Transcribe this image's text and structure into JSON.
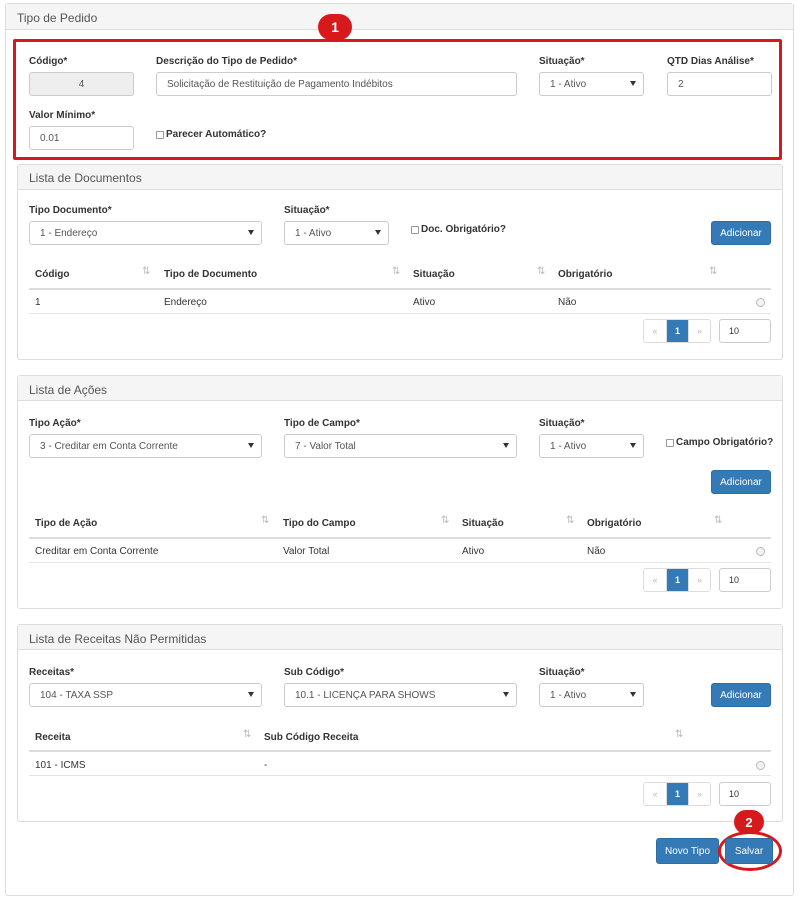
{
  "page": {
    "title": "Tipo de Pedido"
  },
  "order_type": {
    "codigo": {
      "label": "Código*",
      "value": "4"
    },
    "descricao": {
      "label": "Descrição do Tipo de Pedido*",
      "value": "Solicitação de Restituição de Pagamento Indébitos"
    },
    "situacao": {
      "label": "Situação*",
      "value": "1 - Ativo"
    },
    "qtd_dias": {
      "label": "QTD Dias Análise*",
      "value": "2"
    },
    "valor_minimo": {
      "label": "Valor Mínimo*",
      "value": "0.01"
    },
    "parecer": {
      "label": "Parecer Automático?"
    }
  },
  "documentos": {
    "title": "Lista de Documentos",
    "tipo_documento": {
      "label": "Tipo Documento*",
      "value": "1 - Endereço"
    },
    "situacao": {
      "label": "Situação*",
      "value": "1 - Ativo"
    },
    "obrigatorio": {
      "label": "Doc. Obrigatório?"
    },
    "add_label": "Adicionar",
    "columns": [
      "Código",
      "Tipo de Documento",
      "Situação",
      "Obrigatório"
    ],
    "rows": [
      [
        "1",
        "Endereço",
        "Ativo",
        "Não"
      ]
    ],
    "pager": {
      "prev": "«",
      "page": "1",
      "next": "»",
      "size": "10"
    }
  },
  "acoes": {
    "title": "Lista de Ações",
    "tipo_acao": {
      "label": "Tipo Ação*",
      "value": "3 - Creditar em Conta Corrente"
    },
    "tipo_campo": {
      "label": "Tipo de Campo*",
      "value": "7 - Valor Total"
    },
    "situacao": {
      "label": "Situação*",
      "value": "1 - Ativo"
    },
    "obrigatorio": {
      "label": "Campo Obrigatório?"
    },
    "add_label": "Adicionar",
    "columns": [
      "Tipo de Ação",
      "Tipo do Campo",
      "Situação",
      "Obrigatório"
    ],
    "rows": [
      [
        "Creditar em Conta Corrente",
        "Valor Total",
        "Ativo",
        "Não"
      ]
    ],
    "pager": {
      "prev": "«",
      "page": "1",
      "next": "»",
      "size": "10"
    }
  },
  "receitas": {
    "title": "Lista de Receitas Não Permitidas",
    "receitas": {
      "label": "Receitas*",
      "value": "104 - TAXA SSP"
    },
    "sub_codigo": {
      "label": "Sub Código*",
      "value": "10.1 - LICENÇA PARA SHOWS"
    },
    "situacao": {
      "label": "Situação*",
      "value": "1 - Ativo"
    },
    "add_label": "Adicionar",
    "columns": [
      "Receita",
      "Sub Código Receita"
    ],
    "rows": [
      [
        "101 - ICMS",
        "-"
      ]
    ],
    "pager": {
      "prev": "«",
      "page": "1",
      "next": "»",
      "size": "10"
    }
  },
  "footer": {
    "novo_tipo": "Novo Tipo",
    "salvar": "Salvar"
  },
  "annotations": {
    "one": "1",
    "two": "2"
  },
  "colors": {
    "primary": "#337ab7",
    "highlight": "#d7191c"
  },
  "sort_icon": "⇅"
}
